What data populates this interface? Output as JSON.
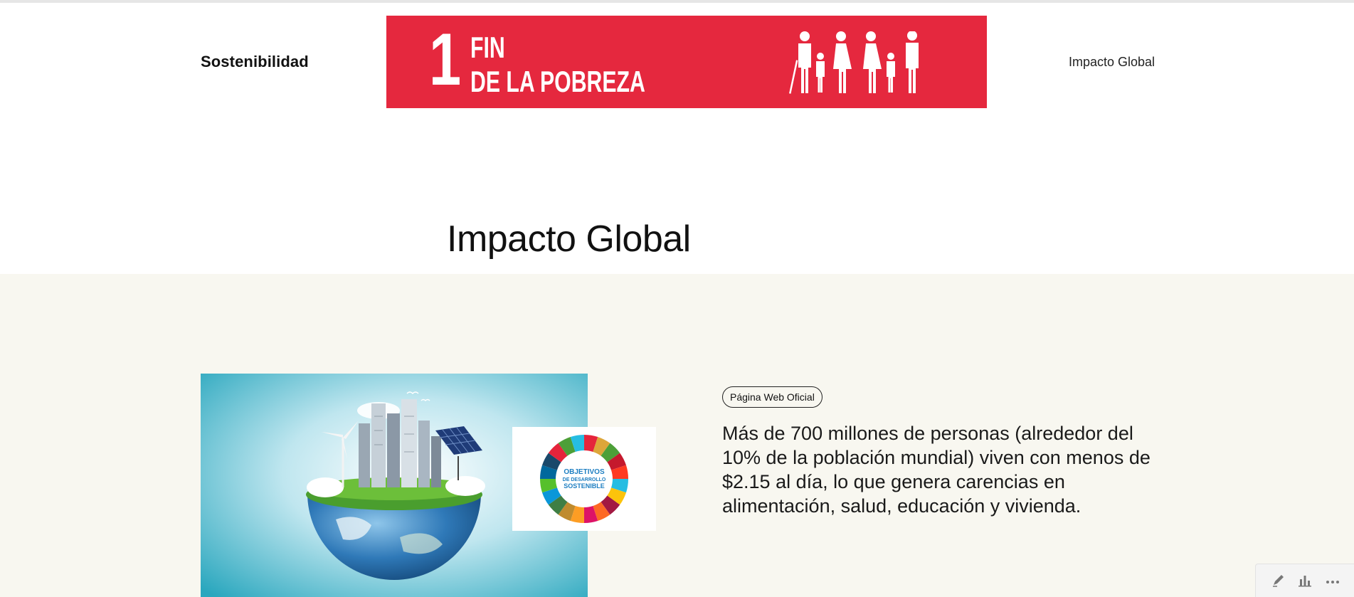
{
  "header": {
    "brand": "Sostenibilidad",
    "nav_link": "Impacto Global",
    "banner": {
      "number": "1",
      "title_line1": "FIN",
      "title_line2": "DE LA POBREZA",
      "color": "#e5283e"
    }
  },
  "main": {
    "title": "Impacto Global",
    "section_bg": "#f8f7f0",
    "badge": "Página Web Oficial",
    "body": "Más de 700 millones de personas (alrededor del 10% de la población mundial) viven con menos de $2.15 al día, lo que genera carencias en alimentación, salud, educación y vivienda.",
    "images": {
      "main": "globe-city-image",
      "overlay": "sdg-wheel-image",
      "overlay_text_line1": "OBJETIVOS",
      "overlay_text_line2": "DE DESARROLLO",
      "overlay_text_line3": "SOSTENIBLE"
    }
  },
  "toolbar": {
    "icons": [
      "edit-icon",
      "bar-chart-icon",
      "more-icon"
    ]
  }
}
